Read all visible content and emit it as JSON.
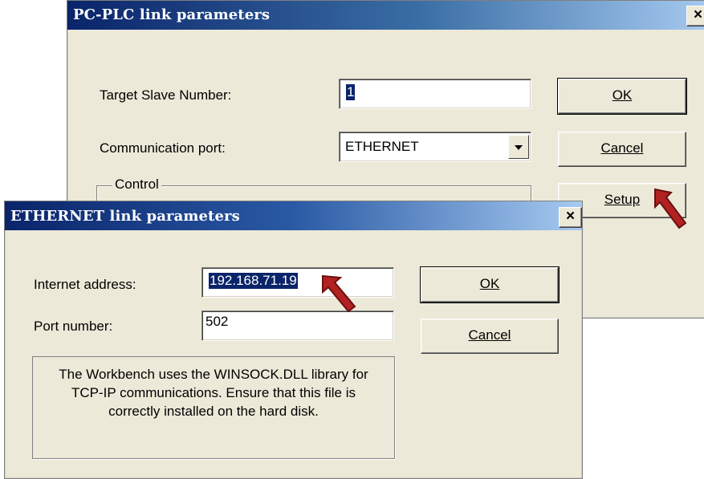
{
  "plc_dialog": {
    "title": "PC-PLC link parameters",
    "close_glyph": "×",
    "target_label": "Target Slave Number:",
    "target_value": "1",
    "port_label": "Communication port:",
    "port_value": "ETHERNET",
    "control_label": "Control",
    "ok_label": "OK",
    "cancel_label": "Cancel",
    "setup_label": "Setup"
  },
  "eth_dialog": {
    "title": "ETHERNET link parameters",
    "close_glyph": "×",
    "ip_label": "Internet address:",
    "ip_value": "192.168.71.19",
    "port_label": "Port number:",
    "port_value": "502",
    "ok_label": "OK",
    "cancel_label": "Cancel",
    "info_text": "The Workbench uses the WINSOCK.DLL library for TCP-IP communications. Ensure that this file is correctly installed on the hard disk."
  },
  "colors": {
    "title_bar_start": "#0a246a",
    "title_bar_end": "#a6caf0",
    "dialog_bg": "#ece9d8",
    "arrow": "#b22222"
  },
  "icons": {
    "close": "close-icon",
    "dropdown": "chevron-down-icon",
    "pointer": "red-arrow-icon"
  }
}
